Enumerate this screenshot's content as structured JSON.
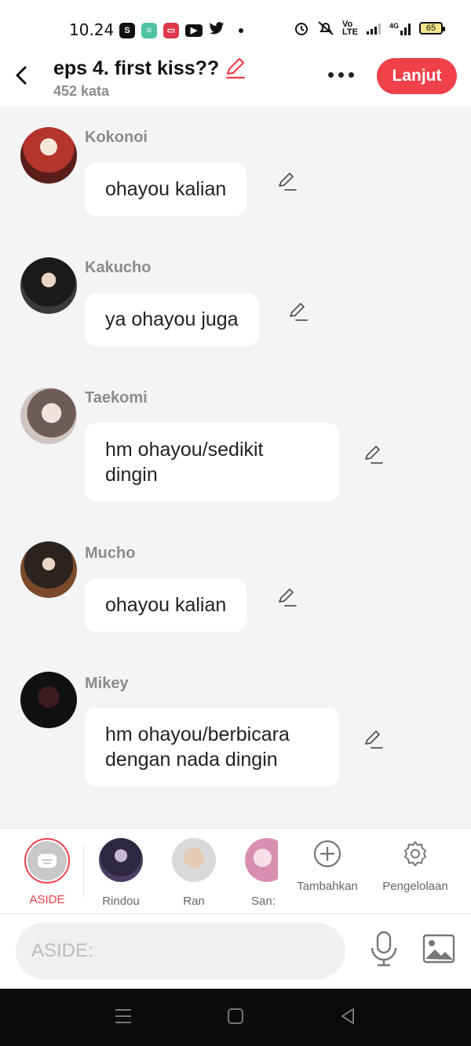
{
  "status_bar": {
    "time": "10.24",
    "battery": "65",
    "app_icons": [
      "shopee-icon",
      "app-green-icon",
      "app-red-icon",
      "youtube-icon",
      "twitter-icon"
    ],
    "system_icons": [
      "alarm-icon",
      "mute-icon",
      "volte-icon",
      "signal-icon",
      "4g-signal-icon"
    ]
  },
  "header": {
    "title": "eps 4. first kiss??",
    "word_count": "452 kata",
    "next_label": "Lanjut"
  },
  "messages": [
    {
      "name": "Kokonoi",
      "text": "ohayou kalian"
    },
    {
      "name": "Kakucho",
      "text": "ya ohayou juga"
    },
    {
      "name": "Taekomi",
      "text": "hm ohayou/sedikit dingin"
    },
    {
      "name": "Mucho",
      "text": "ohayou kalian"
    },
    {
      "name": "Mikey",
      "text": "hm ohayou/berbicara dengan nada dingin"
    }
  ],
  "characters": [
    {
      "label": "ASIDE",
      "selected": true
    },
    {
      "label": "Rindou"
    },
    {
      "label": "Ran"
    },
    {
      "label": "San:"
    }
  ],
  "tools": {
    "add_label": "Tambahkan",
    "manage_label": "Pengelolaan"
  },
  "composer": {
    "placeholder": "ASIDE:"
  },
  "colors": {
    "accent": "#f0404a",
    "background": "#f4f4f4",
    "bubble": "#ffffff",
    "muted_text": "#8c8c8c"
  }
}
